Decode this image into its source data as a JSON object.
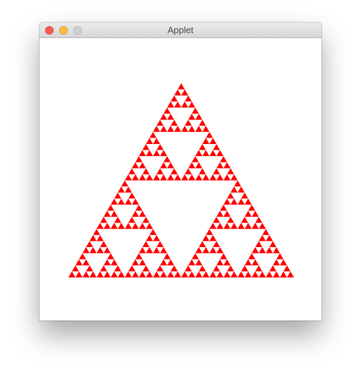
{
  "window": {
    "title": "Applet"
  },
  "controls": {
    "close": "close-button",
    "minimize": "minimize-button",
    "zoom": "zoom-button"
  },
  "colors": {
    "fractal_fill": "#ff0000",
    "canvas_bg": "#ffffff",
    "close": "#fc5753",
    "minimize": "#fdbc40",
    "zoom_disabled": "#d0d0d0"
  },
  "fractal": {
    "kind": "sierpinski-triangle",
    "depth": 5
  }
}
